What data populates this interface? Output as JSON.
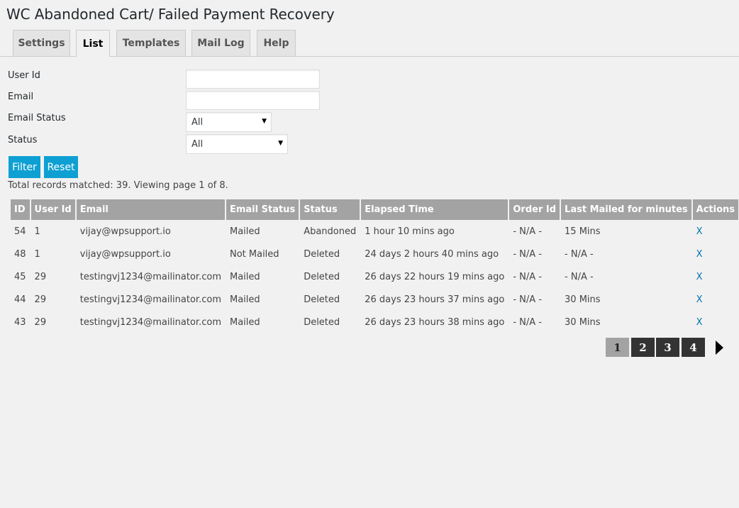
{
  "title": "WC Abandoned Cart/ Failed Payment Recovery",
  "tabs": [
    {
      "label": "Settings"
    },
    {
      "label": "List"
    },
    {
      "label": "Templates"
    },
    {
      "label": "Mail Log"
    },
    {
      "label": "Help"
    }
  ],
  "active_tab": "List",
  "filters": {
    "user_id_label": "User Id",
    "user_id_value": "",
    "email_label": "Email",
    "email_value": "",
    "email_status_label": "Email Status",
    "email_status_value": "All",
    "status_label": "Status",
    "status_value": "All",
    "filter_button": "Filter",
    "reset_button": "Reset"
  },
  "summary": "Total records matched: 39. Viewing page 1 of 8.",
  "table": {
    "headers": [
      "ID",
      "User Id",
      "Email",
      "Email Status",
      "Status",
      "Elapsed Time",
      "Order Id",
      "Last Mailed for minutes",
      "Actions"
    ],
    "rows": [
      [
        "54",
        "1",
        "vijay@wpsupport.io",
        "Mailed",
        "Abandoned",
        "1 hour 10 mins ago",
        "- N/A -",
        "15 Mins",
        "X"
      ],
      [
        "48",
        "1",
        "vijay@wpsupport.io",
        "Not Mailed",
        "Deleted",
        "24 days 2 hours 40 mins ago",
        "- N/A -",
        "- N/A -",
        "X"
      ],
      [
        "45",
        "29",
        "testingvj1234@mailinator.com",
        "Mailed",
        "Deleted",
        "26 days 22 hours 19 mins ago",
        "- N/A -",
        "- N/A -",
        "X"
      ],
      [
        "44",
        "29",
        "testingvj1234@mailinator.com",
        "Mailed",
        "Deleted",
        "26 days 23 hours 37 mins ago",
        "- N/A -",
        "30 Mins",
        "X"
      ],
      [
        "43",
        "29",
        "testingvj1234@mailinator.com",
        "Mailed",
        "Deleted",
        "26 days 23 hours 38 mins ago",
        "- N/A -",
        "30 Mins",
        "X"
      ]
    ]
  },
  "pagination": {
    "pages": [
      "1",
      "2",
      "3",
      "4"
    ],
    "current": "1",
    "next_icon": "next-arrow-icon"
  },
  "colors": {
    "accent": "#0ea0d3",
    "header_bg": "#a3a3a3",
    "link": "#0073aa",
    "background": "#f1f1f1"
  }
}
